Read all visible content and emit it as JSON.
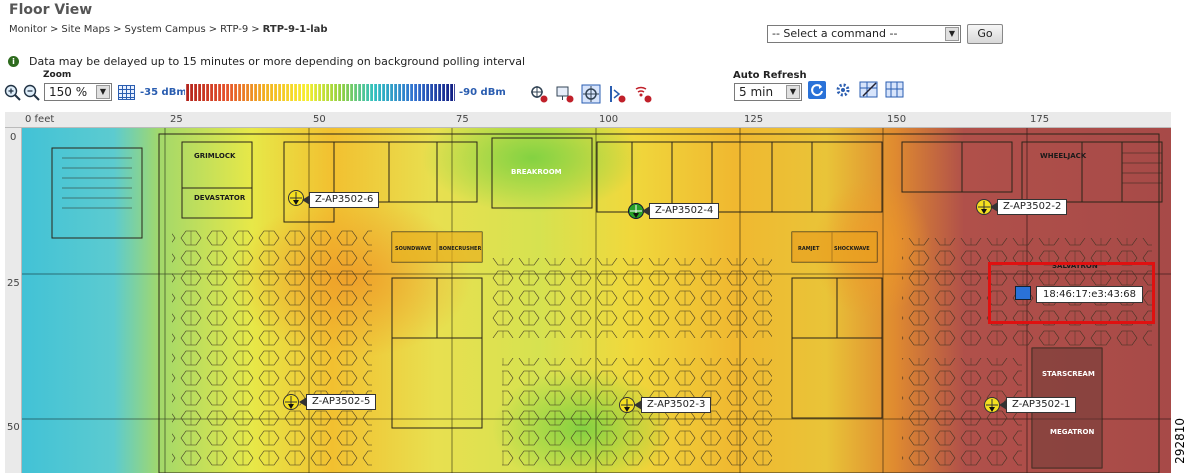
{
  "page": {
    "title": "Floor View"
  },
  "breadcrumb": {
    "items": [
      "Monitor",
      "Site Maps",
      "System Campus",
      "RTP-9"
    ],
    "separator": ">",
    "current": "RTP-9-1-lab"
  },
  "command": {
    "placeholder": "-- Select a command --",
    "go_label": "Go"
  },
  "info": {
    "message": "Data may be delayed up to 15 minutes or more depending on background polling interval"
  },
  "toolbar": {
    "zoom_label": "Zoom",
    "zoom_value": "150 %",
    "legend_min": "-35 dBm",
    "legend_max": "-90 dBm",
    "auto_refresh_label": "Auto Refresh",
    "auto_refresh_value": "5 min"
  },
  "rulers": {
    "x_ticks": [
      "0 feet",
      "25",
      "50",
      "75",
      "100",
      "125",
      "150",
      "175"
    ],
    "y_ticks": [
      "0",
      "25",
      "50"
    ]
  },
  "access_points": [
    {
      "name": "Z-AP3502-6"
    },
    {
      "name": "Z-AP3502-4"
    },
    {
      "name": "Z-AP3502-2"
    },
    {
      "name": "Z-AP3502-5"
    },
    {
      "name": "Z-AP3502-3"
    },
    {
      "name": "Z-AP3502-1"
    }
  ],
  "rooms": {
    "grimlock": "GRIMLOCK",
    "devastator": "DEVASTATOR",
    "breakroom": "BREAKROOM",
    "wheeljack": "WHEELJACK",
    "salvatron": "SALVATRON",
    "soundwave": "SOUNDWAVE",
    "bonecrusher": "BONECRUSHER",
    "ramjet": "RAMJET",
    "shockwave": "SHOCKWAVE",
    "starscream": "STARSCREAM",
    "megatron": "MEGATRON"
  },
  "client": {
    "mac": "18:46:17:e3:43:68"
  },
  "figure_number": "292810",
  "colors": {
    "highlight": "#e01010",
    "rssi_text": "#2a5db0",
    "client": "#2a72d8"
  }
}
